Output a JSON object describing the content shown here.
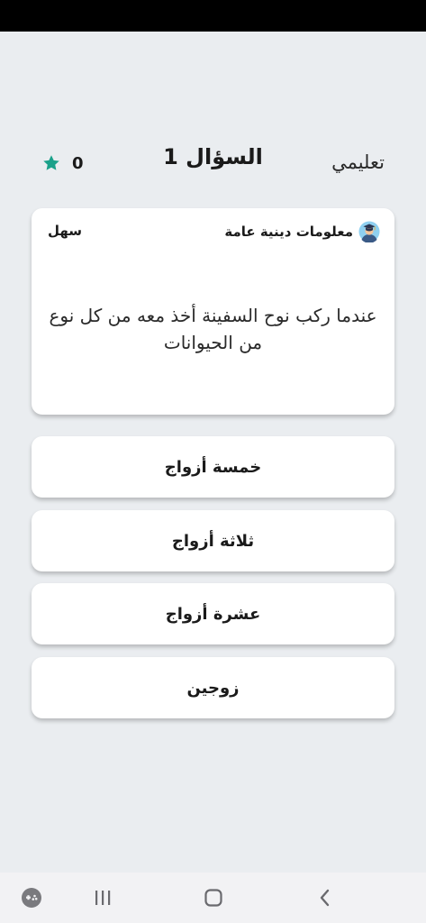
{
  "header": {
    "mode_label": "تعليمي",
    "question_title": "السؤال 1",
    "score": "0",
    "star_color": "#1aa18a"
  },
  "question": {
    "category": "معلومات دينية عامة",
    "difficulty": "سهل",
    "text": "عندما ركب نوح السفينة أخذ معه من كل نوع من الحيوانات"
  },
  "answers": [
    {
      "label": "خمسة أزواج"
    },
    {
      "label": "ثلاثة أزواج"
    },
    {
      "label": "عشرة أزواج"
    },
    {
      "label": "زوجين"
    }
  ],
  "nav": {
    "icons": [
      "game-launcher-icon",
      "recent-apps-icon",
      "home-icon",
      "back-icon"
    ]
  }
}
